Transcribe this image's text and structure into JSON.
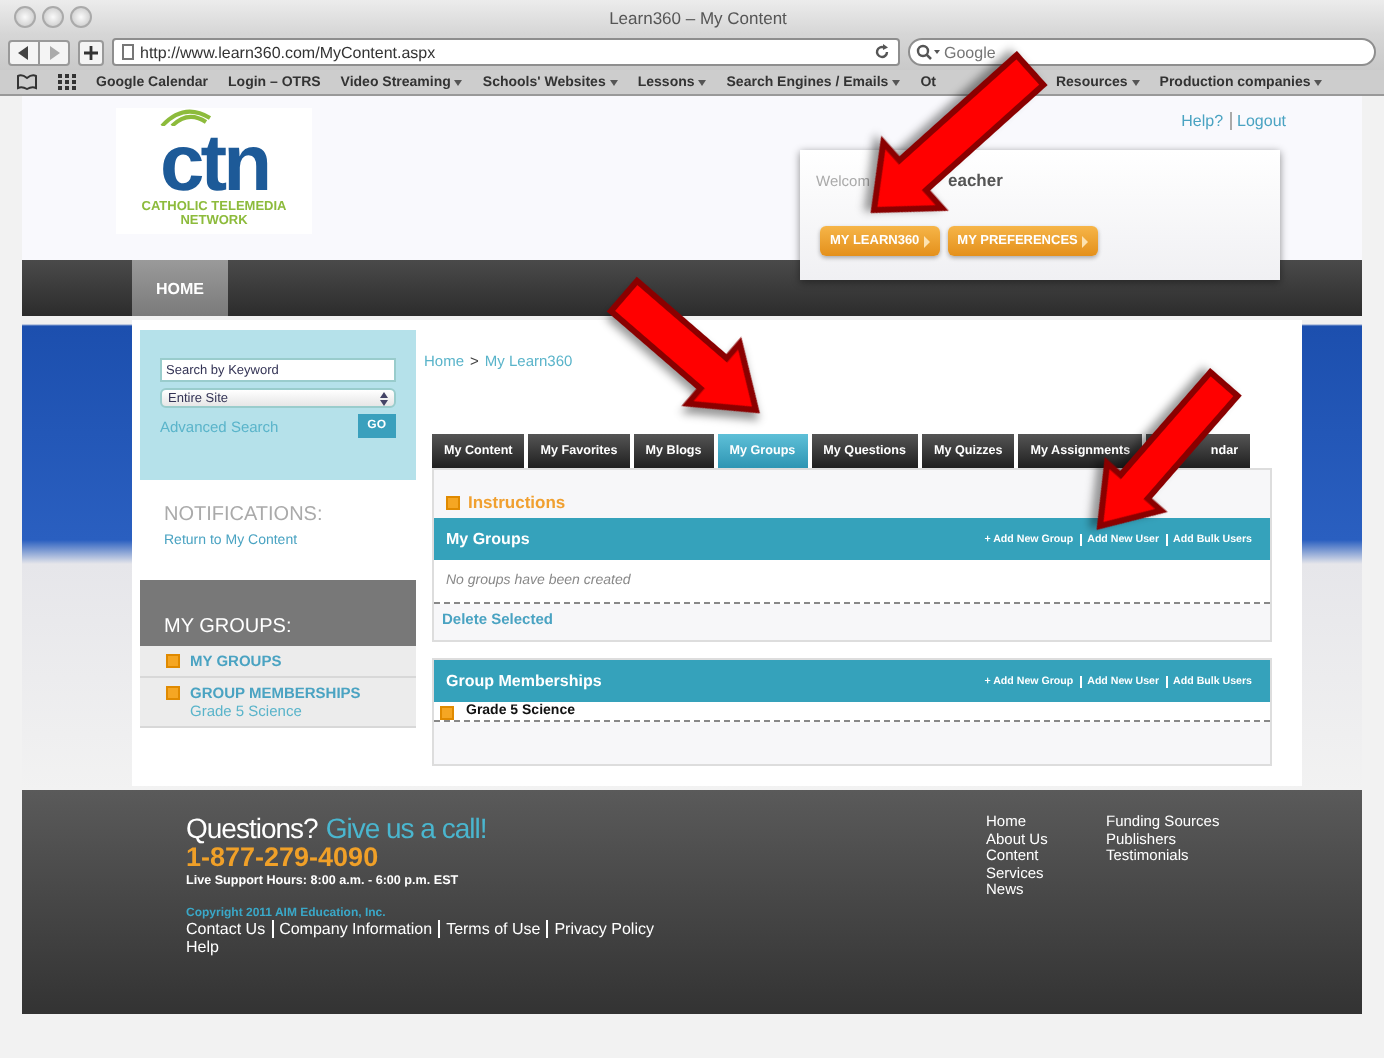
{
  "browser": {
    "title": "Learn360 – My Content",
    "url": "http://www.learn360.com/MyContent.aspx",
    "search_placeholder": "Google",
    "bookmarks": [
      {
        "label": "Google Calendar",
        "menu": false
      },
      {
        "label": "Login – OTRS",
        "menu": false
      },
      {
        "label": "Video Streaming",
        "menu": true
      },
      {
        "label": "Schools' Websites",
        "menu": true
      },
      {
        "label": "Lessons",
        "menu": true
      },
      {
        "label": "Search Engines / Emails",
        "menu": true
      },
      {
        "label": "Ot",
        "menu": false
      },
      {
        "label": "Resources",
        "menu": true
      },
      {
        "label": "Production companies",
        "menu": true
      }
    ]
  },
  "header": {
    "logo": {
      "mark": "ctn",
      "line_1": "CATHOLIC TELEMEDIA",
      "line_2": "NETWORK"
    },
    "top_links": [
      "Help?",
      "Logout"
    ],
    "welcome": [
      "Welcom",
      "eacher"
    ],
    "buttons": [
      "MY LEARN360",
      "MY PREFERENCES"
    ]
  },
  "nav": [
    {
      "label": "HOME",
      "selected": true
    }
  ],
  "sidebar": {
    "search_value": "Search by Keyword",
    "scope": "Entire Site",
    "advanced": "Advanced Search",
    "go": "GO",
    "notifications_title": "NOTIFICATIONS:",
    "notifications_link": "Return to My Content",
    "groups_title": "MY GROUPS:",
    "groups": [
      {
        "label": "MY GROUPS"
      },
      {
        "label": "GROUP MEMBERSHIPS",
        "children": [
          {
            "label": "Grade 5 Science"
          }
        ]
      }
    ]
  },
  "main": {
    "breadcrumb": [
      "Home",
      "My Learn360"
    ],
    "breadcrumb_separator": ">",
    "tabs": [
      {
        "label": "My Content",
        "selected": false
      },
      {
        "label": "My Favorites",
        "selected": false
      },
      {
        "label": "My Blogs",
        "selected": false
      },
      {
        "label": "My Groups",
        "selected": true
      },
      {
        "label": "My Questions",
        "selected": false
      },
      {
        "label": "My Quizzes",
        "selected": false
      },
      {
        "label": "My Assignments",
        "selected": false
      },
      {
        "label": "ndar",
        "selected": false
      }
    ],
    "instructions": "Instructions",
    "panels": [
      {
        "title": "My Groups",
        "actions": [
          "+ Add New Group",
          "Add New User",
          "Add Bulk Users"
        ],
        "rows": [
          {
            "kind": "empty",
            "text": "No groups have been created"
          }
        ],
        "footer_link": "Delete Selected"
      },
      {
        "title": "Group Memberships",
        "actions": [
          "+ Add New Group",
          "Add New User",
          "Add Bulk Users"
        ],
        "rows": [
          {
            "kind": "group",
            "text": "Grade 5 Science"
          }
        ]
      }
    ]
  },
  "footer": {
    "question": "Questions?",
    "call": "Give us a call!",
    "phone": "1-877-279-4090",
    "hours": "Live Support Hours: 8:00 a.m. - 6:00 p.m. EST",
    "copyright": "Copyright 2011 AIM Education, Inc.",
    "links": [
      "Contact Us",
      "Company Information",
      "Terms of Use",
      "Privacy Policy"
    ],
    "help": "Help",
    "columns": [
      [
        "Home",
        "About Us",
        "Content",
        "Services",
        "News"
      ],
      [
        "Funding Sources",
        "Publishers",
        "Testimonials"
      ]
    ]
  }
}
